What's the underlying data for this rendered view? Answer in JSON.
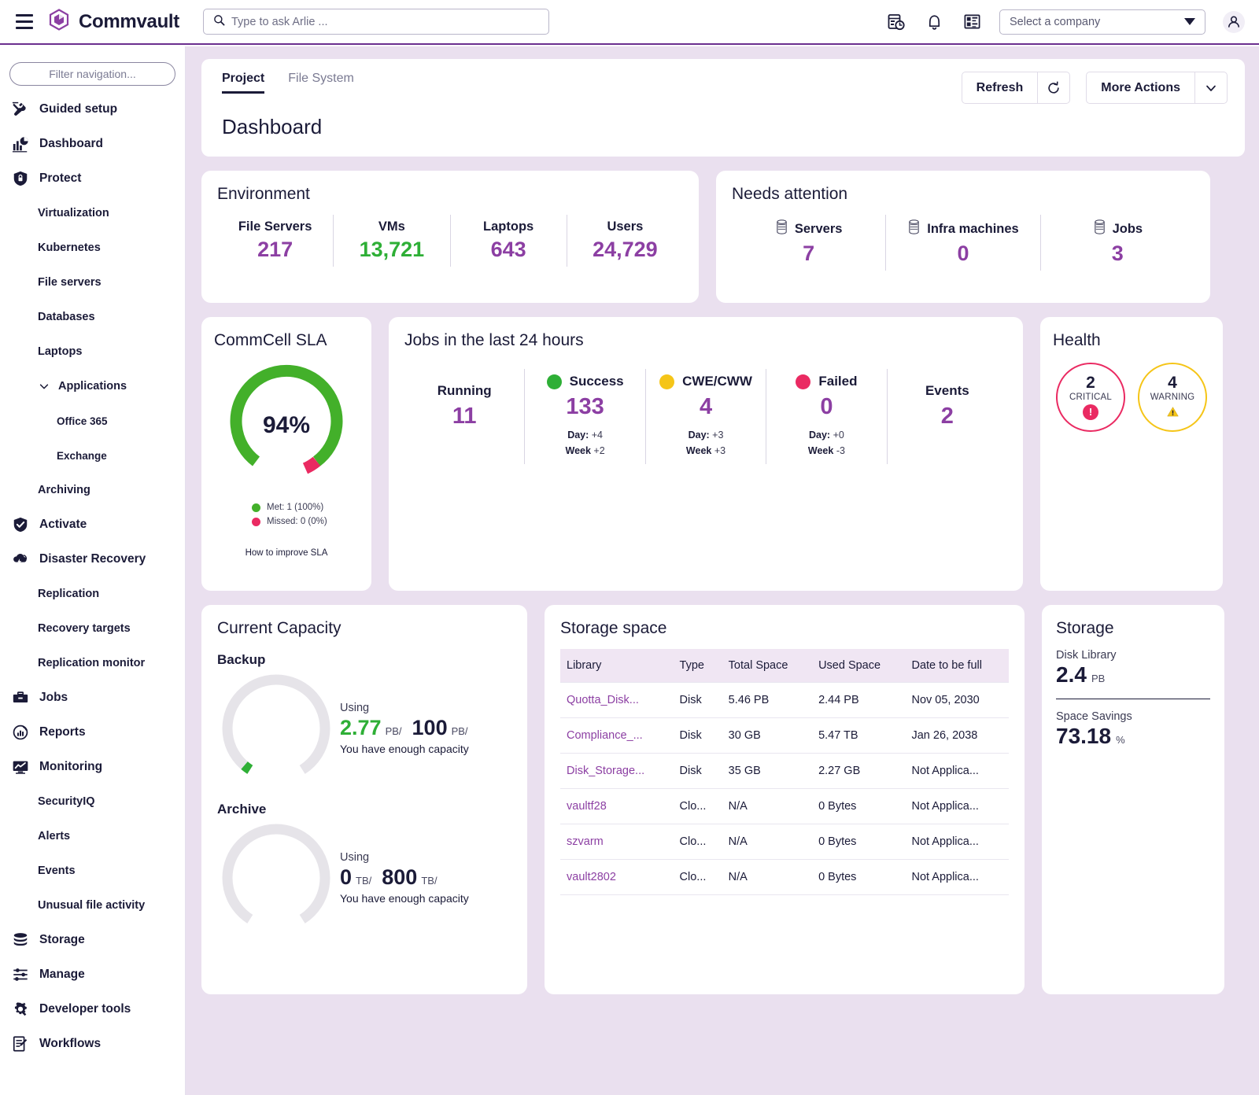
{
  "topbar": {
    "brand": "Commvault",
    "search_placeholder": "Type to ask Arlie ...",
    "company_select_value": "Select a company",
    "icons": [
      "job-history-icon",
      "bell-icon",
      "documentation-icon",
      "user-avatar-icon"
    ]
  },
  "sidebar": {
    "filter_placeholder": "Filter navigation...",
    "items": [
      {
        "label": "Guided setup",
        "level": 0,
        "icon": "tools-icon"
      },
      {
        "label": "Dashboard",
        "level": 0,
        "icon": "chart-icon"
      },
      {
        "label": "Protect",
        "level": 0,
        "icon": "shield-lock-icon"
      },
      {
        "label": "Virtualization",
        "level": 1,
        "icon": ""
      },
      {
        "label": "Kubernetes",
        "level": 1,
        "icon": ""
      },
      {
        "label": "File servers",
        "level": 1,
        "icon": ""
      },
      {
        "label": "Databases",
        "level": 1,
        "icon": ""
      },
      {
        "label": "Laptops",
        "level": 1,
        "icon": ""
      },
      {
        "label": "Applications",
        "level": 1,
        "icon": "chevron-down-icon"
      },
      {
        "label": "Office 365",
        "level": 2,
        "icon": ""
      },
      {
        "label": "Exchange",
        "level": 2,
        "icon": ""
      },
      {
        "label": "Archiving",
        "level": 1,
        "icon": ""
      },
      {
        "label": "Activate",
        "level": 0,
        "icon": "shield-check-icon"
      },
      {
        "label": "Disaster Recovery",
        "level": 0,
        "icon": "cloud-recovery-icon"
      },
      {
        "label": "Replication",
        "level": 1,
        "icon": ""
      },
      {
        "label": "Recovery targets",
        "level": 1,
        "icon": ""
      },
      {
        "label": "Replication monitor",
        "level": 1,
        "icon": ""
      },
      {
        "label": "Jobs",
        "level": 0,
        "icon": "briefcase-icon"
      },
      {
        "label": "Reports",
        "level": 0,
        "icon": "report-chart-icon"
      },
      {
        "label": "Monitoring",
        "level": 0,
        "icon": "monitor-icon"
      },
      {
        "label": "SecurityIQ",
        "level": 1,
        "icon": ""
      },
      {
        "label": "Alerts",
        "level": 1,
        "icon": ""
      },
      {
        "label": "Events",
        "level": 1,
        "icon": ""
      },
      {
        "label": "Unusual file activity",
        "level": 1,
        "icon": ""
      },
      {
        "label": "Storage",
        "level": 0,
        "icon": "database-stack-icon"
      },
      {
        "label": "Manage",
        "level": 0,
        "icon": "sliders-icon"
      },
      {
        "label": "Developer tools",
        "level": 0,
        "icon": "gear-wrench-icon"
      },
      {
        "label": "Workflows",
        "level": 0,
        "icon": "workflow-doc-icon"
      }
    ]
  },
  "page": {
    "tabs": [
      {
        "label": "Project",
        "active": true
      },
      {
        "label": "File System",
        "active": false
      }
    ],
    "refresh_label": "Refresh",
    "more_actions_label": "More Actions",
    "title": "Dashboard"
  },
  "environment": {
    "title": "Environment",
    "stats": [
      {
        "label": "File Servers",
        "value": "217",
        "color": "purple"
      },
      {
        "label": "VMs",
        "value": "13,721",
        "color": "green"
      },
      {
        "label": "Laptops",
        "value": "643",
        "color": "purple"
      },
      {
        "label": "Users",
        "value": "24,729",
        "color": "purple"
      }
    ]
  },
  "needs_attention": {
    "title": "Needs attention",
    "stats": [
      {
        "label": "Servers",
        "value": "7",
        "icon": "database-icon"
      },
      {
        "label": "Infra machines",
        "value": "0",
        "icon": "database-icon"
      },
      {
        "label": "Jobs",
        "value": "3",
        "icon": "database-icon"
      }
    ]
  },
  "sla": {
    "title": "CommCell SLA",
    "percent_label": "94%",
    "met_legend": "Met: 1 (100%)",
    "missed_legend": "Missed: 0 (0%)",
    "link": "How to improve SLA",
    "met_color": "#43b02a",
    "missed_color": "#ea2a62"
  },
  "jobs": {
    "title": "Jobs in the last 24 hours",
    "columns": [
      {
        "label": "Running",
        "value": "11",
        "dot": "",
        "day": "",
        "week": ""
      },
      {
        "label": "Success",
        "value": "133",
        "dot": "#2eaf36",
        "day_label": "Day:",
        "day": "+4",
        "week_label": "Week",
        "week": "+2"
      },
      {
        "label": "CWE/CWW",
        "value": "4",
        "dot": "#f5c518",
        "day_label": "Day:",
        "day": "+3",
        "week_label": "Week",
        "week": "+3"
      },
      {
        "label": "Failed",
        "value": "0",
        "dot": "#ea2a62",
        "day_label": "Day:",
        "day": "+0",
        "week_label": "Week",
        "week": "-3"
      },
      {
        "label": "Events",
        "value": "2",
        "dot": "",
        "day": "",
        "week": ""
      }
    ]
  },
  "health": {
    "title": "Health",
    "items": [
      {
        "count": "2",
        "label": "CRITICAL",
        "color": "#ea2a62",
        "badge": "!"
      },
      {
        "count": "4",
        "label": "WARNING",
        "color": "#f5c518",
        "badge": "⚠"
      }
    ]
  },
  "capacity": {
    "title": "Current Capacity",
    "blocks": [
      {
        "name": "Backup",
        "using_label": "Using",
        "used": "2.77",
        "used_unit": "PB/",
        "total": "100",
        "total_unit": "PB/",
        "message": "You have enough capacity",
        "percent": 2.77,
        "arc_color": "#2eaf36"
      },
      {
        "name": "Archive",
        "using_label": "Using",
        "used": "0",
        "used_unit": "TB/",
        "total": "800",
        "total_unit": "TB/",
        "message": "You have enough capacity",
        "percent": 0,
        "arc_color": "#2eaf36"
      }
    ]
  },
  "storage_space": {
    "title": "Storage space",
    "columns": [
      "Library",
      "Type",
      "Total Space",
      "Used Space",
      "Date to be full"
    ],
    "rows": [
      [
        "Quotta_Disk...",
        "Disk",
        "5.46 PB",
        "2.44 PB",
        "Nov 05, 2030"
      ],
      [
        "Compliance_...",
        "Disk",
        "30 GB",
        "5.47 TB",
        "Jan 26, 2038"
      ],
      [
        "Disk_Storage...",
        "Disk",
        "35 GB",
        "2.27 GB",
        "Not Applica..."
      ],
      [
        "vaultf28",
        "Clo...",
        "N/A",
        "0 Bytes",
        "Not Applica..."
      ],
      [
        "szvarm",
        "Clo...",
        "N/A",
        "0 Bytes",
        "Not Applica..."
      ],
      [
        "vault2802",
        "Clo...",
        "N/A",
        "0 Bytes",
        "Not Applica..."
      ]
    ]
  },
  "storage": {
    "title": "Storage",
    "disk_library_label": "Disk Library",
    "disk_library_value": "2.4",
    "disk_library_unit": "PB",
    "space_savings_label": "Space Savings",
    "space_savings_value": "73.18",
    "space_savings_unit": "%"
  },
  "theme": {
    "accent_purple": "#8c3fa3",
    "brand_purple": "#6b2f8f",
    "bg_lavender": "#eae0ef",
    "green": "#2eaf36",
    "pink": "#ea2a62",
    "yellow": "#f5c518",
    "navy": "#1b1b38"
  }
}
